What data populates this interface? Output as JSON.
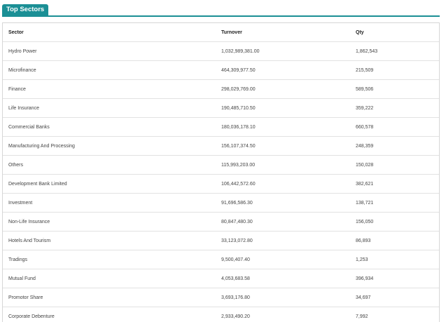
{
  "tab": {
    "label": "Top Sectors"
  },
  "table": {
    "headers": [
      "Sector",
      "Turnover",
      "Qty"
    ],
    "rows": [
      [
        "Hydro Power",
        "1,032,989,381.00",
        "1,862,543"
      ],
      [
        "Microfinance",
        "464,309,977.50",
        "215,509"
      ],
      [
        "Finance",
        "298,029,769.00",
        "589,506"
      ],
      [
        "Life Insurance",
        "190,485,710.50",
        "359,222"
      ],
      [
        "Commercial Banks",
        "180,036,178.10",
        "660,578"
      ],
      [
        "Manufacturing And Processing",
        "156,107,374.50",
        "248,359"
      ],
      [
        "Others",
        "115,993,203.00",
        "150,028"
      ],
      [
        "Development Bank Limited",
        "106,442,572.60",
        "382,621"
      ],
      [
        "Investment",
        "91,696,586.30",
        "138,721"
      ],
      [
        "Non-Life Insurance",
        "80,847,480.30",
        "156,050"
      ],
      [
        "Hotels And Tourism",
        "33,123,072.80",
        "86,893"
      ],
      [
        "Tradings",
        "9,500,407.40",
        "1,253"
      ],
      [
        "Mutual Fund",
        "4,053,683.58",
        "396,934"
      ],
      [
        "Promotor Share",
        "3,693,176.80",
        "34,697"
      ],
      [
        "Corporate Debenture",
        "2,933,490.20",
        "7,992"
      ]
    ]
  },
  "colors": {
    "accent": "#1b8f95",
    "border": "#d6d6d6",
    "text": "#444444"
  }
}
